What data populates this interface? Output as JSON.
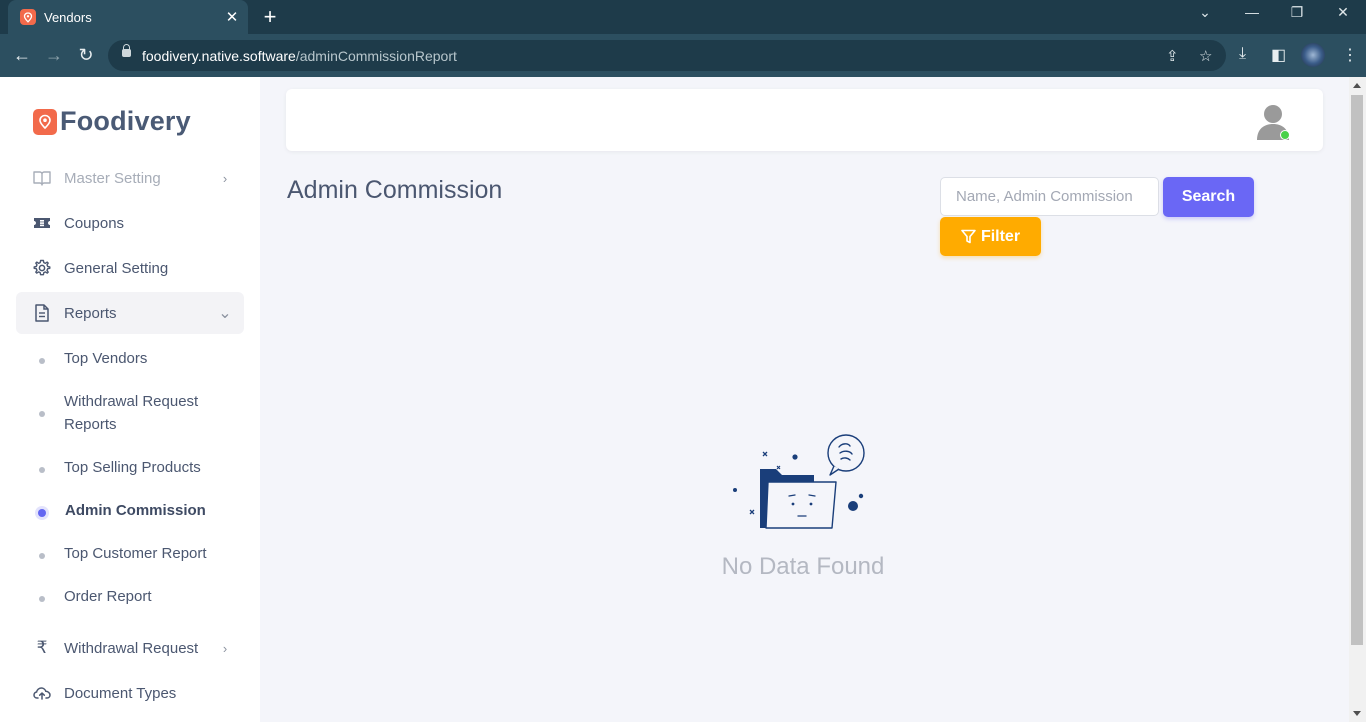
{
  "browser": {
    "tab_title": "Vendors",
    "url_host": "foodivery.native.software",
    "url_path": "/adminCommissionReport"
  },
  "brand": {
    "name": "Foodivery",
    "color": "#f26a4b"
  },
  "sidebar": {
    "items": [
      {
        "label": "Master Setting",
        "icon": "book-icon"
      },
      {
        "label": "Coupons",
        "icon": "ticket-icon"
      },
      {
        "label": "General Setting",
        "icon": "gear-icon"
      },
      {
        "label": "Reports",
        "icon": "document-icon"
      }
    ],
    "reports_sub": [
      {
        "label": "Top Vendors"
      },
      {
        "label": "Withdrawal Request Reports"
      },
      {
        "label": "Top Selling Products"
      },
      {
        "label": "Admin Commission"
      },
      {
        "label": "Top Customer Report"
      },
      {
        "label": "Order Report"
      }
    ],
    "bottom_items": [
      {
        "label": "Withdrawal Request",
        "icon": "rupee-icon"
      },
      {
        "label": "Document Types",
        "icon": "cloud-upload-icon"
      }
    ]
  },
  "main": {
    "title": "Admin Commission",
    "search_placeholder": "Name, Admin Commission",
    "search_label": "Search",
    "filter_label": "Filter",
    "empty_text": "No Data Found"
  },
  "colors": {
    "primary": "#6a67f5",
    "filter": "#ffab00",
    "active_dot": "#6366f1",
    "online": "#4ad14a"
  }
}
